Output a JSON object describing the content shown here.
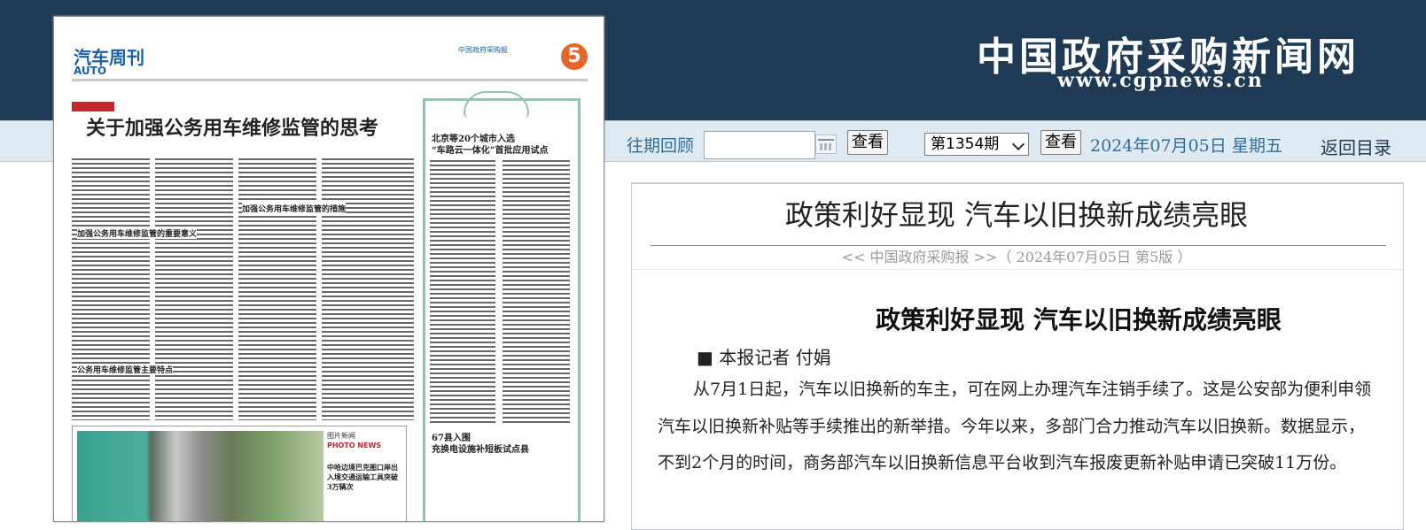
{
  "header": {
    "site_title": "中国政府采购新闻网",
    "site_url": "www.cgpnews.cn"
  },
  "controls": {
    "archive_label": "往期回顾",
    "date_input_value": "",
    "view_button_1": "查看",
    "issue_select": "第1354期",
    "view_button_2": "查看",
    "date_text": "2024年07月05日",
    "weekday_text": "星期五",
    "return_link": "返回目录"
  },
  "newspaper": {
    "section": "汽车周刊",
    "section_en": "AUTO",
    "masthead": "中国政府采购报",
    "page_number": "5",
    "headline": "关于加强公务用车维修监管的思考",
    "subhead_1": "加强公务用车维修监管的重要意义",
    "subhead_2": "加强公务用车维修监管的措施",
    "subhead_3": "公务用车维修监管主要特点",
    "sidebar_title": "北京等20个城市入选\n“车路云一体化”首批应用试点",
    "sidebar_title_2": "67县入围\n充换电设施补短板试点县",
    "photo_label": "图片新闻",
    "photo_label_en": "PHOTO NEWS",
    "photo_caption": "中哈边境巴克图口岸出入境交通运输工具突破3万辆次"
  },
  "article": {
    "title": "政策利好显现 汽车以旧换新成绩亮眼",
    "source_line": "<< 中国政府采购报 >>（ 2024年07月05日 第5版 ）",
    "body_title": "政策利好显现 汽车以旧换新成绩亮眼",
    "author": "■ 本报记者 付娟",
    "paragraph_1": "从7月1日起，汽车以旧换新的车主，可在网上办理汽车注销手续了。这是公安部为便利申领汽车以旧换新补贴等手续推出的新举措。今年以来，多部门合力推动汽车以旧换新。数据显示，不到2个月的时间，商务部汽车以旧换新信息平台收到汽车报废更新补贴申请已突破11万份。"
  },
  "colors": {
    "header_bg": "#1f3a55",
    "control_bar_bg": "#dfe9f1",
    "link_blue": "#2e6e9e",
    "paper_accent_blue": "#1b5fa7",
    "paper_accent_red": "#c1272d",
    "paper_accent_green": "#8cc7b4"
  }
}
